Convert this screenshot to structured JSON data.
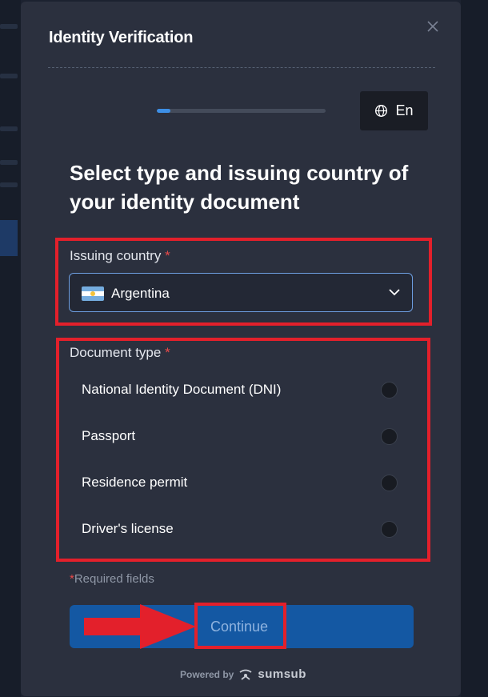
{
  "modal": {
    "title": "Identity Verification",
    "close_icon": "close-icon",
    "progress": 0.08
  },
  "language": {
    "label": "En",
    "icon": "globe-icon"
  },
  "heading": "Select type and issuing country of your identity document",
  "country": {
    "label": "Issuing country",
    "required_mark": "*",
    "value": "Argentina",
    "flag_icon": "argentina-flag-icon"
  },
  "document_type": {
    "label": "Document type",
    "required_mark": "*",
    "options": [
      {
        "label": "National Identity Document (DNI)",
        "selected": false
      },
      {
        "label": "Passport",
        "selected": false
      },
      {
        "label": "Residence permit",
        "selected": false
      },
      {
        "label": "Driver's license",
        "selected": false
      }
    ]
  },
  "required_note": {
    "mark": "*",
    "text": "Required fields"
  },
  "continue_label": "Continue",
  "footer": {
    "powered_by": "Powered by",
    "brand": "sumsub"
  },
  "colors": {
    "modal_bg": "#2b303e",
    "accent_button": "#1458a3",
    "required": "#e84a4a",
    "annotation": "#e3202b",
    "select_border": "#6d9ee0"
  }
}
